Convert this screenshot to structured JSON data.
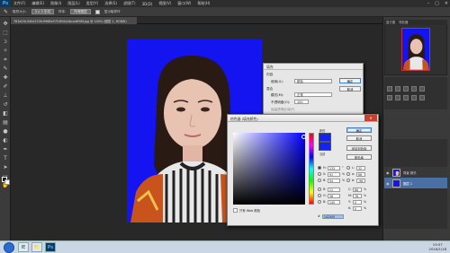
{
  "app": {
    "logo": "Ps",
    "menu": [
      "文件(F)",
      "编辑(E)",
      "图像(I)",
      "图层(L)",
      "类型(Y)",
      "选择(S)",
      "滤镜(T)",
      "3D(D)",
      "视图(V)",
      "窗口(W)",
      "帮助(H)"
    ],
    "window_controls": [
      "–",
      "▢",
      "✕"
    ]
  },
  "options": {
    "size_label": "取样大小:",
    "size_value": "3 x 3 平均",
    "sample_label": "样本:",
    "sample_value": "所有图层",
    "show_ring": "显示取样环"
  },
  "document": {
    "tab": "783e29c340e253fc9968e97f1694a3bca4698f.jpg @ 100% (图层 1, RGB/8)"
  },
  "navigator": {
    "tabs": [
      "直方图",
      "导航器"
    ]
  },
  "layers": {
    "items": [
      {
        "name": "背景 拷贝"
      },
      {
        "name": "图层 1"
      }
    ]
  },
  "hue_sat": {
    "title": "填充",
    "content_label": "内容",
    "use_label": "使用(U):",
    "use_value": "颜色",
    "blend_label": "混合",
    "mode_label": "模式(M):",
    "mode_value": "正常",
    "opacity_label": "不透明度(O):",
    "opacity_value": "100",
    "preserve_label": "保留透明区域(P)",
    "ok": "确定",
    "cancel": "取消"
  },
  "picker": {
    "title": "拾色器 (填充颜色)",
    "close": "✕",
    "new_label": "新的",
    "current_label": "当前",
    "ok": "确定",
    "cancel": "取消",
    "add_swatch": "添加到色板",
    "libraries": "颜色库",
    "web_only": "只有 Web 颜色",
    "fields": {
      "H": "233",
      "S": "91",
      "B": "94",
      "R": "21",
      "G": "36",
      "Bb": "240",
      "L": "32",
      "a": "66",
      "b": "-96",
      "C": "86",
      "M": "76",
      "Y": "0",
      "K": "0"
    },
    "hex_label": "#",
    "hex": "1424f0",
    "swatch_color": "#1424f0"
  },
  "taskbar": {
    "items": [
      "IE",
      "📁",
      "Ps"
    ],
    "active": 2
  },
  "clock": {
    "time": "19:57",
    "date": "2016/1/18"
  }
}
